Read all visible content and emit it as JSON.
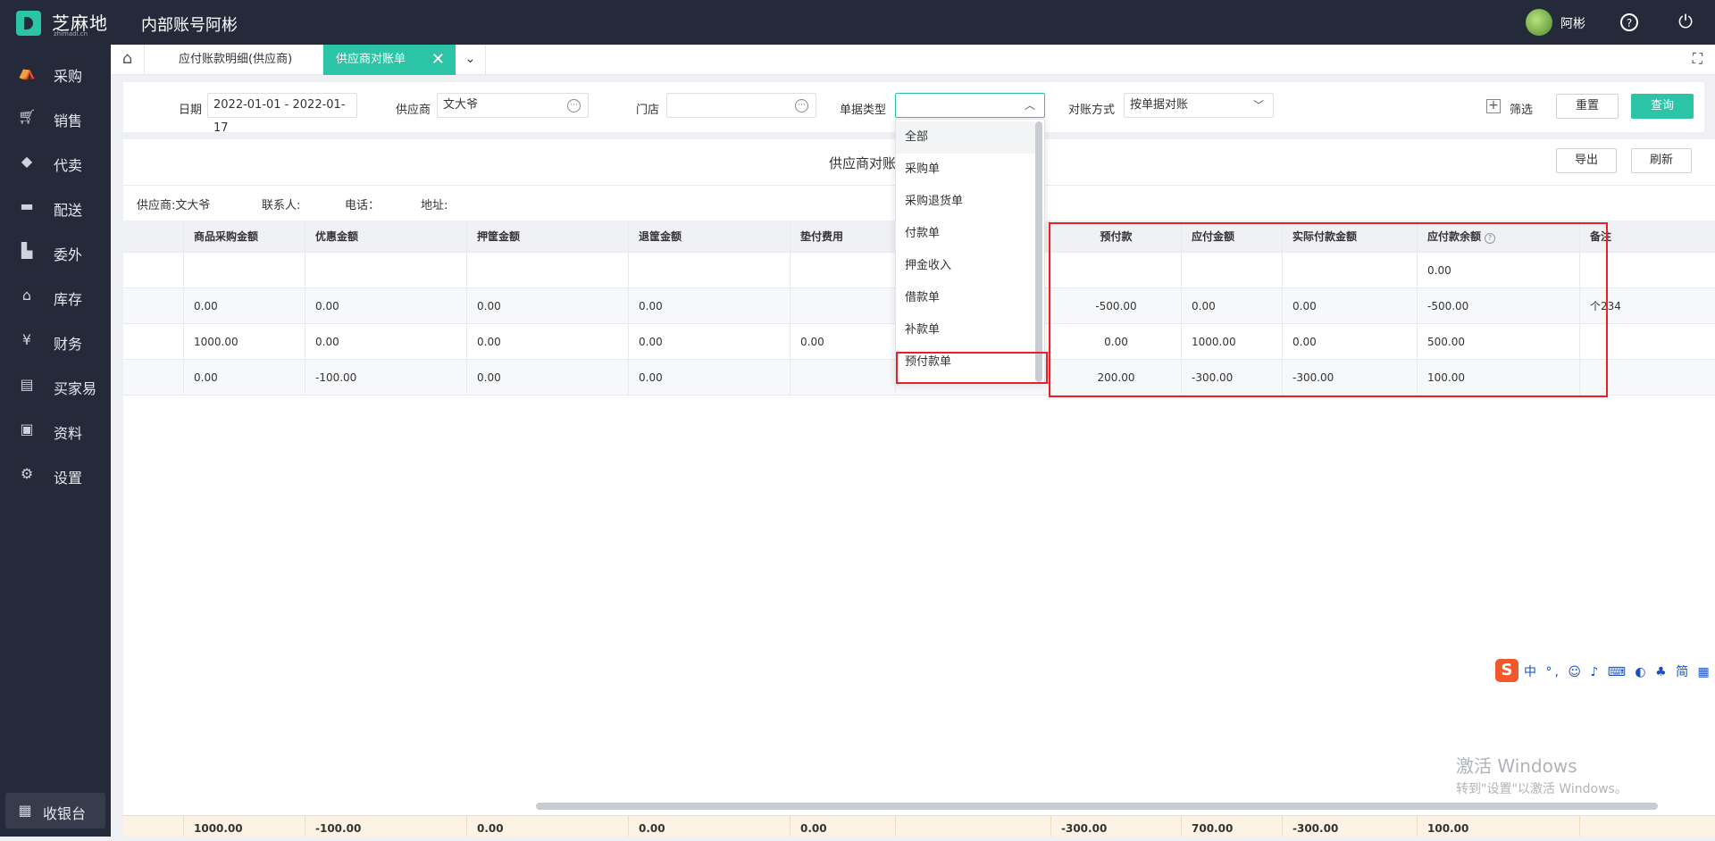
{
  "header": {
    "logo_text": "芝麻地",
    "logo_sub": "zhimadi.cn",
    "app_title": "内部账号阿彬",
    "user_name": "阿彬"
  },
  "sidebar": {
    "items": [
      {
        "label": "采购",
        "icon": "basket-icon"
      },
      {
        "label": "销售",
        "icon": "cart-icon"
      },
      {
        "label": "代卖",
        "icon": "tag-icon"
      },
      {
        "label": "配送",
        "icon": "truck-icon"
      },
      {
        "label": "委外",
        "icon": "building-icon"
      },
      {
        "label": "库存",
        "icon": "warehouse-icon"
      },
      {
        "label": "财务",
        "icon": "yen-icon"
      },
      {
        "label": "买家易",
        "icon": "store-icon"
      },
      {
        "label": "资料",
        "icon": "printer-icon"
      },
      {
        "label": "设置",
        "icon": "gear-icon"
      }
    ],
    "cashier_label": "收银台"
  },
  "tabs": {
    "tab1": "应付账款明细(供应商)",
    "tab2": "供应商对账单"
  },
  "filters": {
    "date_label": "日期",
    "date_value": "2022-01-01 - 2022-01-17",
    "supplier_label": "供应商",
    "supplier_value": "文大爷",
    "store_label": "门店",
    "store_value": "",
    "doc_type_label": "单据类型",
    "doc_type_value": "",
    "recon_label": "对账方式",
    "recon_value": "按单据对账",
    "filter_label": "筛选",
    "reset_label": "重置",
    "query_label": "查询"
  },
  "report": {
    "title": "供应商对账单",
    "export_label": "导出",
    "refresh_label": "刷新",
    "supplier_info": "供应商:文大爷",
    "contact_info": "联系人:",
    "phone_info": "电话：",
    "address_info": "地址:"
  },
  "table": {
    "columns": [
      "",
      "商品采购金额",
      "优惠金额",
      "押筐金额",
      "退筐金额",
      "垫付费用",
      "",
      "预付款",
      "应付金额",
      "实际付款金额",
      "应付款余额",
      "备注"
    ],
    "rows": [
      [
        "",
        "",
        "",
        "",
        "",
        "",
        "",
        "",
        "",
        "",
        "0.00",
        ""
      ],
      [
        "",
        "0.00",
        "0.00",
        "0.00",
        "0.00",
        "",
        "",
        "-500.00",
        "0.00",
        "0.00",
        "-500.00",
        "个234"
      ],
      [
        "",
        "1000.00",
        "0.00",
        "0.00",
        "0.00",
        "0.00",
        "",
        "0.00",
        "1000.00",
        "0.00",
        "500.00",
        ""
      ],
      [
        "",
        "0.00",
        "-100.00",
        "0.00",
        "0.00",
        "",
        "",
        "200.00",
        "-300.00",
        "-300.00",
        "100.00",
        ""
      ]
    ],
    "totals": [
      "",
      "1000.00",
      "-100.00",
      "0.00",
      "0.00",
      "0.00",
      "",
      "-300.00",
      "700.00",
      "-300.00",
      "100.00",
      ""
    ]
  },
  "dropdown": {
    "options": [
      "全部",
      "采购单",
      "采购退货单",
      "付款单",
      "押金收入",
      "借款单",
      "补款单",
      "预付款单"
    ],
    "selected": "全部",
    "highlighted": "预付款单"
  },
  "ime": {
    "logo": "S",
    "text": "中 °, ☺ ♪ ⌨ ◐ ♣ 简 ▦"
  },
  "watermark": {
    "line1": "激活 Windows",
    "line2": "转到\"设置\"以激活 Windows。"
  },
  "colors": {
    "accent": "#2bc4a6",
    "sidebar_bg": "#242a3a",
    "highlight": "#e8202a"
  }
}
